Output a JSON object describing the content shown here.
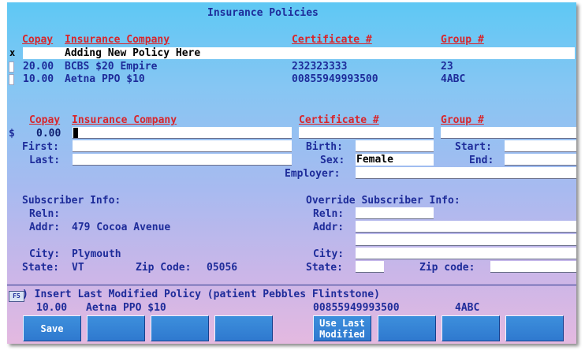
{
  "window": {
    "title": "Insurance Policies"
  },
  "list": {
    "headers": {
      "copay": "Copay",
      "company": "Insurance Company",
      "certificate": "Certificate #",
      "group": "Group #"
    },
    "rows": [
      {
        "marker": "x",
        "copay": "",
        "company": "Adding New Policy Here",
        "certificate": "",
        "group": ""
      },
      {
        "marker": "",
        "copay": "20.00",
        "company": "BCBS $20 Empire",
        "certificate": "232323333",
        "group": "23"
      },
      {
        "marker": "",
        "copay": "10.00",
        "company": "Aetna PPO $10",
        "certificate": "00855949993500",
        "group": "4ABC"
      }
    ]
  },
  "form": {
    "headers": {
      "copay": "Copay",
      "company": "Insurance Company",
      "certificate": "Certificate #",
      "group": "Group #"
    },
    "currency": "$",
    "copay_value": "0.00",
    "labels": {
      "first": "First:",
      "last": "Last:",
      "birth": "Birth:",
      "sex": "Sex:",
      "start": "Start:",
      "end": "End:",
      "employer": "Employer:"
    },
    "sex_value": "Female"
  },
  "subscriber": {
    "title": "Subscriber Info:",
    "reln_label": "Reln:",
    "addr_label": "Addr:",
    "addr_value": "479 Cocoa Avenue",
    "city_label": "City:",
    "city_value": "Plymouth",
    "state_label": "State:",
    "state_value": "VT",
    "zip_label": "Zip Code:",
    "zip_value": "05056"
  },
  "override": {
    "title": "Override Subscriber Info:",
    "reln_label": "Reln:",
    "addr_label": "Addr:",
    "city_label": "City:",
    "state_label": "State:",
    "zip_label": "Zip code:"
  },
  "insert": {
    "key": "F5",
    "text": ") Insert Last Modified Policy (patient Pebbles Flintstone)",
    "copay": "10.00",
    "company": "Aetna PPO $10",
    "certificate": "00855949993500",
    "group": "4ABC"
  },
  "buttons": {
    "save": "Save",
    "use_last_line1": "Use Last",
    "use_last_line2": "Modified"
  },
  "colors": {
    "label": "#1e2c9a",
    "header": "#d8262c",
    "button": "#2f79cf"
  }
}
